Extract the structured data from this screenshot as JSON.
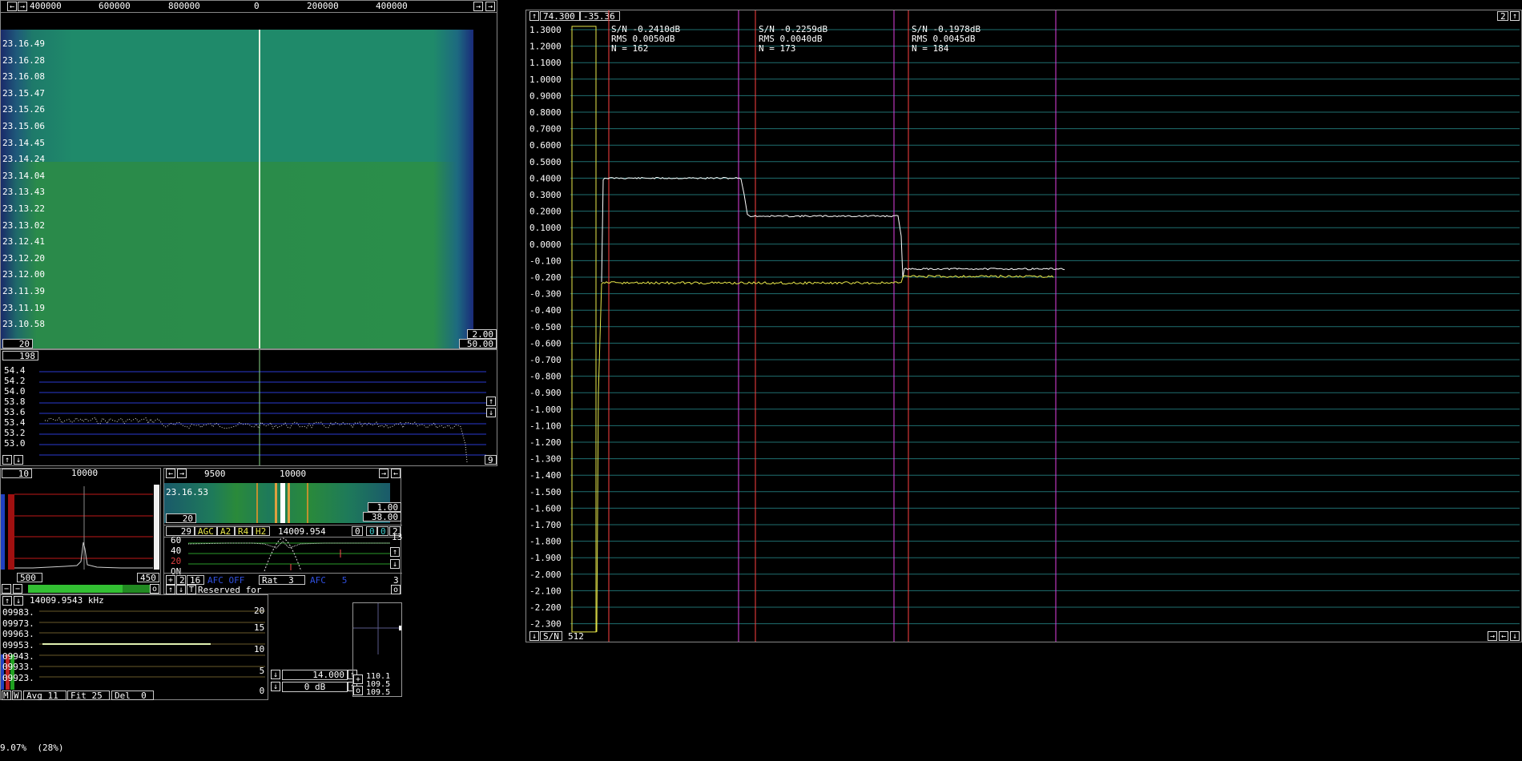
{
  "waterfall": {
    "freq_ticks": [
      "400000",
      "600000",
      "800000",
      "0",
      "200000",
      "400000"
    ],
    "times": [
      "23.16.49",
      "23.16.28",
      "23.16.08",
      "23.15.47",
      "23.15.26",
      "23.15.06",
      "23.14.45",
      "23.14.24",
      "23.14.04",
      "23.13.43",
      "23.13.22",
      "23.13.02",
      "23.12.41",
      "23.12.20",
      "23.12.00",
      "23.11.39",
      "23.11.19",
      "23.10.58"
    ],
    "bottom_left": "20",
    "gain": "2.00",
    "zero": "50.00",
    "nav_left": "←",
    "nav_right": "→",
    "nav_far_right": "→"
  },
  "spectrum": {
    "top_value": "198",
    "y_labels": [
      "54.4",
      "54.2",
      "54.0",
      "53.8",
      "53.6",
      "53.4",
      "53.2",
      "53.0"
    ],
    "right_value": "9",
    "up_label": "↑",
    "down_label": "↓"
  },
  "baseband_small": {
    "top_left": "10",
    "top_center": "10000",
    "bottom_left": "500",
    "bottom_right": "450"
  },
  "hires": {
    "ticks": [
      "9500",
      "10000"
    ],
    "time": "23.16.53",
    "gain": "1.00",
    "zero": "38.00",
    "left_value": "20",
    "row_items": [
      "29",
      "AGC",
      "A2",
      "R4",
      "H2"
    ],
    "frequency": "14009.954",
    "right_items": [
      "0",
      "0",
      "0",
      "2"
    ],
    "y_labels": [
      "60",
      "40",
      "20",
      "ON"
    ],
    "right_value": "13",
    "bottom_left": "2",
    "bottom_val": "16",
    "afc_label": "AFC OFF",
    "rat_label": "Rat",
    "rat_value": "3",
    "afc2_label": "AFC",
    "afc2_value": "5",
    "bottom_right": "3",
    "reserved": "Reserved for"
  },
  "freq_panel": {
    "frequency": "14009.9543 kHz",
    "rows": [
      "09983.",
      "09973.",
      "09963.",
      "09953.",
      "09943.",
      "09933.",
      "09923."
    ],
    "scale": [
      "20",
      "15",
      "10",
      "5",
      "0"
    ],
    "mode_m": "M",
    "mode_w": "W",
    "avg": "Avg 11",
    "fit": "Fit 25",
    "del": "Del  0"
  },
  "s_meter": {
    "value1": "14.000",
    "value2": "0 dB",
    "readings": [
      "110.1",
      "109.5",
      "109.5"
    ]
  },
  "graph": {
    "top_left_a": "74.300",
    "top_left_b": "-35.36",
    "top_right": "2",
    "stats": [
      {
        "sn": "S/N -0.2410dB",
        "rms": "RMS 0.0050dB",
        "n": "N = 162"
      },
      {
        "sn": "S/N -0.2259dB",
        "rms": "RMS 0.0040dB",
        "n": "N = 173"
      },
      {
        "sn": "S/N -0.1978dB",
        "rms": "RMS 0.0045dB",
        "n": "N = 184"
      }
    ],
    "y_labels": [
      "1.3000",
      "1.2000",
      "1.1000",
      "1.0000",
      "0.9000",
      "0.8000",
      "0.7000",
      "0.6000",
      "0.5000",
      "0.4000",
      "0.3000",
      "0.2000",
      "0.1000",
      "0.0000",
      "-0.100",
      "-0.200",
      "-0.300",
      "-0.400",
      "-0.500",
      "-0.600",
      "-0.700",
      "-0.800",
      "-0.900",
      "-1.000",
      "-1.100",
      "-1.200",
      "-1.300",
      "-1.400",
      "-1.500",
      "-1.600",
      "-1.700",
      "-1.800",
      "-1.900",
      "-2.000",
      "-2.100",
      "-2.200",
      "-2.300"
    ],
    "bottom_mode": "S/N",
    "bottom_value": "512"
  },
  "status": "9.07%  (28%)",
  "colors": {
    "grid": "#1f6f70",
    "white_trace": "#ffffff",
    "yellow_trace": "#e8e84a",
    "red_marker": "#ff4040",
    "magenta_marker": "#e040e0"
  }
}
